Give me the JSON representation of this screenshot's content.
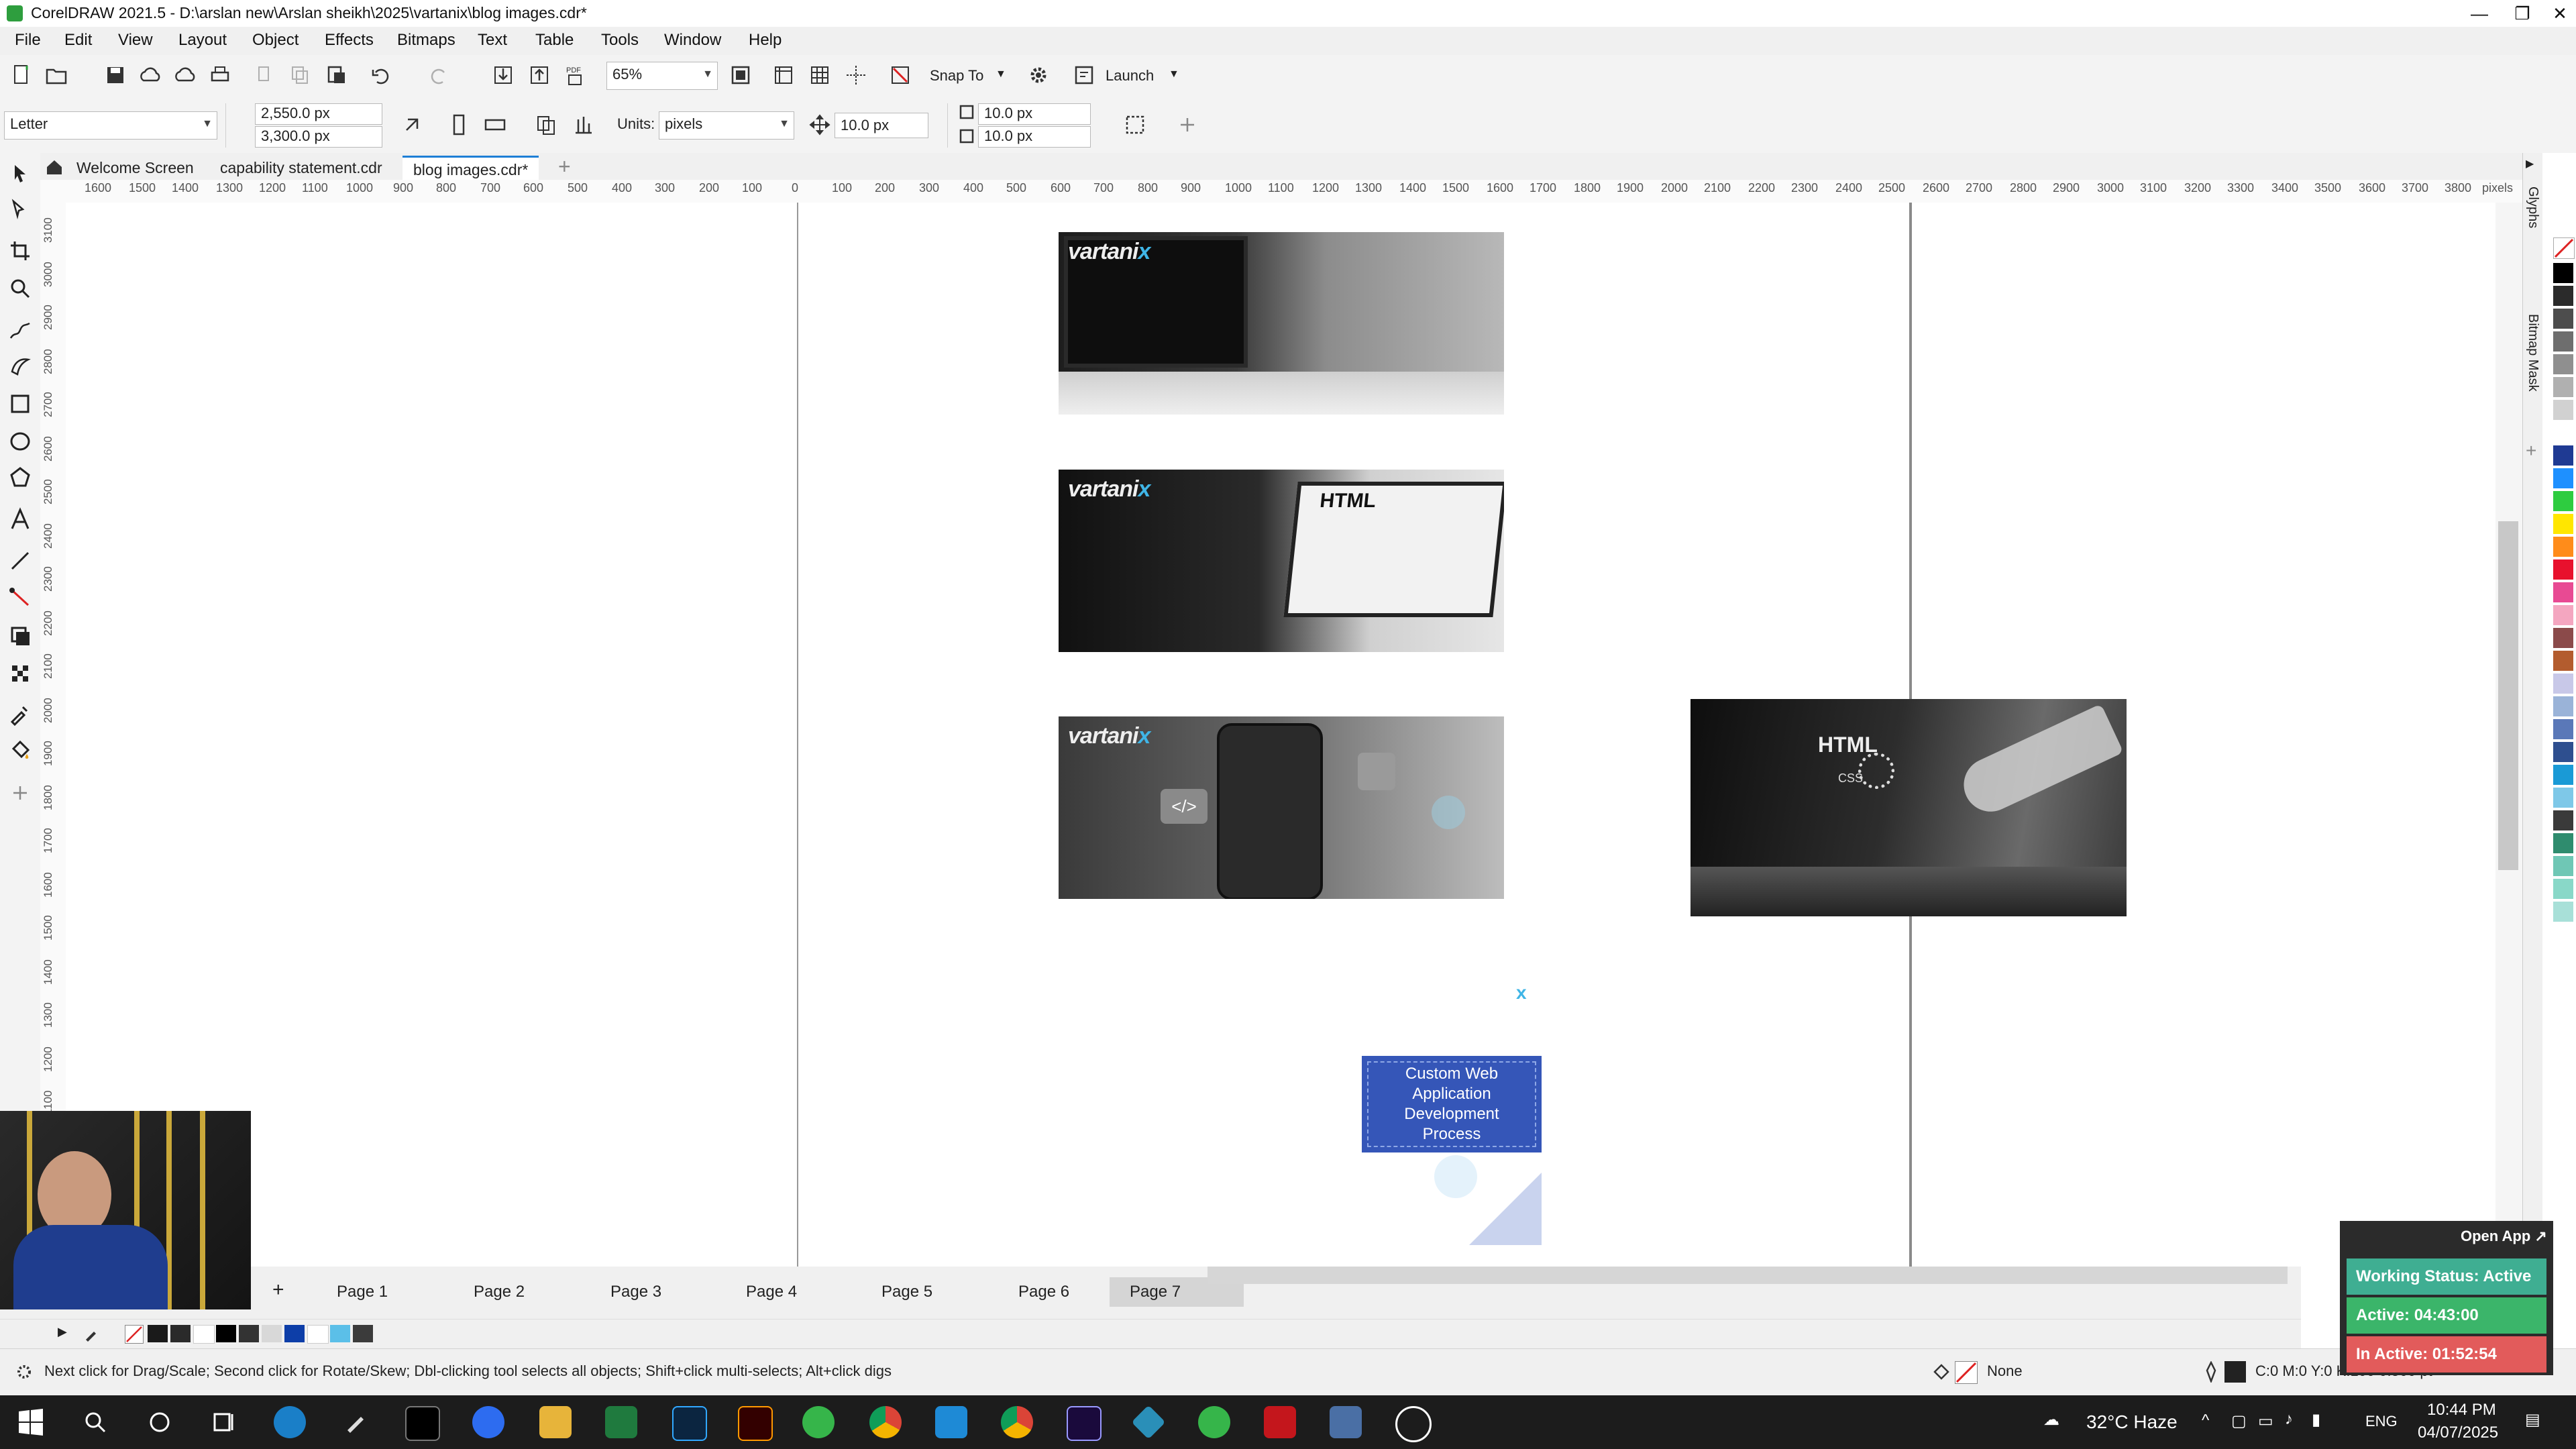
{
  "window": {
    "title": "CorelDRAW 2021.5 - D:\\arslan new\\Arslan sheikh\\2025\\vartanix\\blog images.cdr*",
    "minimize": "—",
    "restore": "❐",
    "close": "✕"
  },
  "menu": [
    "File",
    "Edit",
    "View",
    "Layout",
    "Object",
    "Effects",
    "Bitmaps",
    "Text",
    "Table",
    "Tools",
    "Window",
    "Help"
  ],
  "toolbar": {
    "zoom": "65%",
    "snap_to": "Snap To",
    "launch": "Launch",
    "pdf": "PDF"
  },
  "property_bar": {
    "page_size": "Letter",
    "width": "2,550.0 px",
    "height": "3,300.0 px",
    "units_label": "Units:",
    "units_value": "pixels",
    "nudge": "10.0 px",
    "dup_x": "10.0 px",
    "dup_y": "10.0 px"
  },
  "doc_tabs": [
    "Welcome Screen",
    "capability statement.cdr",
    "blog images.cdr*"
  ],
  "ruler": {
    "h_ticks": [
      "1600",
      "1500",
      "1400",
      "1300",
      "1200",
      "1100",
      "1000",
      "900",
      "800",
      "700",
      "600",
      "500",
      "400",
      "300",
      "200",
      "100",
      "0",
      "100",
      "200",
      "300",
      "400",
      "500",
      "600",
      "700",
      "800",
      "900",
      "1000",
      "1100",
      "1200",
      "1300",
      "1400",
      "1500",
      "1600",
      "1700",
      "1800",
      "1900",
      "2000",
      "2100",
      "2200",
      "2300",
      "2400",
      "2500",
      "2600",
      "2700",
      "2800",
      "2900",
      "3000",
      "3100",
      "3200",
      "3300",
      "3400",
      "3500",
      "3600",
      "3700",
      "3800"
    ],
    "unit": "pixels",
    "v_ticks": [
      "3100",
      "3000",
      "2900",
      "2800",
      "2700",
      "2600",
      "2500",
      "2400",
      "2300",
      "2200",
      "2100",
      "2000",
      "1900",
      "1800",
      "1700",
      "1600",
      "1500",
      "1400",
      "1300",
      "1200",
      "1100"
    ]
  },
  "canvas": {
    "brand_left": "vartani",
    "brand_x": "x",
    "img2_label": "HTML",
    "img4_label": "HTML",
    "img4_sub": "CSS",
    "box_lines": [
      "Custom Web",
      "Application",
      "Development",
      "Process"
    ]
  },
  "docker_tabs": [
    "Glyphs",
    "Bitmap Mask"
  ],
  "pages": [
    "Page 1",
    "Page 2",
    "Page 3",
    "Page 4",
    "Page 5",
    "Page 6",
    "Page 7"
  ],
  "status": {
    "hint": "Next click for Drag/Scale; Second click for Rotate/Skew; Dbl-clicking tool selects all objects; Shift+click multi-selects; Alt+click digs",
    "fill_label": "None",
    "outline_label": "C:0 M:0 Y:0 K:100 0.500 pt"
  },
  "widget": {
    "open_app": "Open App ↗",
    "working": "Working Status: Active",
    "active": "Active: 04:43:00",
    "inactive": "In Active: 01:52:54"
  },
  "tray": {
    "temp": "32°C Haze",
    "lang": "ENG",
    "time": "10:44 PM",
    "date": "04/07/2025"
  },
  "colors": {
    "accent_tab": "#1e7fd6",
    "blue_box": "#3556b8",
    "widget_green": "#3bb56a",
    "widget_red": "#e25b5b"
  },
  "palette": [
    "#000000",
    "#2b2b2b",
    "#4d4d4d",
    "#6e6e6e",
    "#8f8f8f",
    "#b0b0b0",
    "#d1d1d1",
    "#ffffff",
    "#1f3a93",
    "#1e90ff",
    "#2ecc40",
    "#ffe600",
    "#ff8c1a",
    "#e8112d",
    "#e84a93",
    "#f4a6c0",
    "#8b4a4a",
    "#b35c2e",
    "#c8c8e8",
    "#9ab3d8",
    "#5a78b8",
    "#2e4f8f",
    "#1a9ad6",
    "#7ec8e8",
    "#3a3a3a",
    "#2f8c6e",
    "#6fc7b5",
    "#89d8c8",
    "#a8e0d8"
  ]
}
